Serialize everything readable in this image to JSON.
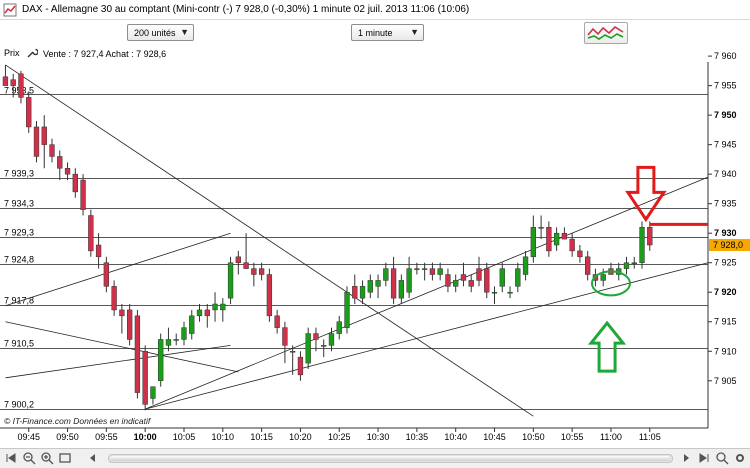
{
  "window": {
    "title": "DAX - Allemagne 30 au comptant (Mini-contr (-)   7 928,0 (-0,30%)     1 minute   02 juil. 2013 11:06 (10:06)"
  },
  "toolbar": {
    "units_select": "200 unités",
    "timeframe_select": "1 minute"
  },
  "quote": {
    "prix_label": "Prix",
    "vente_achat": "Vente : 7 927,4  Achat : 7 928,6"
  },
  "watermark": "© IT-Finance.com   Données en indicatif",
  "colors": {
    "bull": "#1a9e1a",
    "bear": "#d0314a",
    "red_arrow": "#e41a1a",
    "green_arrow": "#1fa83a",
    "current_price_bg": "#f5a800"
  },
  "chart_data": {
    "type": "candlestick",
    "interval": "1 minute",
    "ylim": [
      7897,
      7959
    ],
    "y_ticks": [
      7905,
      7910,
      7915,
      7920,
      7925,
      7930,
      7935,
      7940,
      7945,
      7950,
      7955,
      7960
    ],
    "y_tick_labels": [
      "7 905",
      "7 910",
      "7 915",
      "7 920",
      "7 925",
      "7 930",
      "7 935",
      "7 940",
      "7 945",
      "7 950",
      "7 955",
      "7 960"
    ],
    "y_bold_labels": [
      "7 920",
      "7 930",
      "7 950"
    ],
    "x_labels": [
      "09:45",
      "09:50",
      "09:55",
      "10:00",
      "10:05",
      "10:10",
      "10:15",
      "10:20",
      "10:25",
      "10:30",
      "10:35",
      "10:40",
      "10:45",
      "10:50",
      "10:55",
      "11:00",
      "11:05"
    ],
    "x_label_minutes": [
      585,
      590,
      595,
      600,
      605,
      610,
      615,
      620,
      625,
      630,
      635,
      640,
      645,
      650,
      655,
      660,
      665
    ],
    "x_bold_label": "10:00",
    "current_price": "7 928,0",
    "current_price_value": 7928,
    "horizontal_levels": [
      {
        "value": 7953.5,
        "label": ""
      },
      {
        "value": 7939.3,
        "label": "7 939,3"
      },
      {
        "value": 7934.3,
        "label": "7 934,3"
      },
      {
        "value": 7929.3,
        "label": "7 929,3"
      },
      {
        "value": 7924.8,
        "label": "7 924,8"
      },
      {
        "value": 7917.8,
        "label": "7 917,8"
      },
      {
        "value": 7910.5,
        "label": "7 910,5"
      },
      {
        "value": 7900.2,
        "label": "7 900,2"
      }
    ],
    "extra_level_labels": [
      {
        "value": 7955.7,
        "label": "7 953,5"
      }
    ],
    "trendlines": [
      {
        "from": [
          582,
          7958.5
        ],
        "to": [
          650,
          7899
        ]
      },
      {
        "from": [
          582,
          7917.7
        ],
        "to": [
          611,
          7930.0
        ]
      },
      {
        "from": [
          582,
          7905.5
        ],
        "to": [
          611,
          7911.0
        ]
      },
      {
        "from": [
          600,
          7900.2
        ],
        "to": [
          672.5,
          7939.5
        ]
      },
      {
        "from": [
          600,
          7900.2
        ],
        "to": [
          672.5,
          7925.0
        ]
      },
      {
        "from": [
          582,
          7915.0
        ],
        "to": [
          612,
          7906.5
        ]
      }
    ],
    "candles": [
      {
        "t": 582,
        "o": 7956.5,
        "h": 7958.5,
        "l": 7955,
        "c": 7955
      },
      {
        "t": 583,
        "o": 7956,
        "h": 7957,
        "l": 7953,
        "c": 7955
      },
      {
        "t": 584,
        "o": 7957,
        "h": 7957.5,
        "l": 7952,
        "c": 7953
      },
      {
        "t": 585,
        "o": 7953,
        "h": 7954,
        "l": 7947,
        "c": 7948
      },
      {
        "t": 586,
        "o": 7948,
        "h": 7949,
        "l": 7942,
        "c": 7943
      },
      {
        "t": 587,
        "o": 7948,
        "h": 7950,
        "l": 7941,
        "c": 7945
      },
      {
        "t": 588,
        "o": 7945,
        "h": 7946,
        "l": 7942,
        "c": 7943
      },
      {
        "t": 589,
        "o": 7943,
        "h": 7944,
        "l": 7939,
        "c": 7941
      },
      {
        "t": 590,
        "o": 7941,
        "h": 7942,
        "l": 7939,
        "c": 7940
      },
      {
        "t": 591,
        "o": 7940,
        "h": 7941,
        "l": 7936,
        "c": 7937
      },
      {
        "t": 592,
        "o": 7939,
        "h": 7940,
        "l": 7933,
        "c": 7934
      },
      {
        "t": 593,
        "o": 7933,
        "h": 7934,
        "l": 7926,
        "c": 7927
      },
      {
        "t": 594,
        "o": 7928,
        "h": 7930,
        "l": 7924,
        "c": 7926
      },
      {
        "t": 595,
        "o": 7925,
        "h": 7926,
        "l": 7920,
        "c": 7921
      },
      {
        "t": 596,
        "o": 7921,
        "h": 7922,
        "l": 7916,
        "c": 7917
      },
      {
        "t": 597,
        "o": 7917,
        "h": 7918,
        "l": 7913,
        "c": 7916
      },
      {
        "t": 598,
        "o": 7917,
        "h": 7918,
        "l": 7911,
        "c": 7912
      },
      {
        "t": 599,
        "o": 7916,
        "h": 7917,
        "l": 7902,
        "c": 7903
      },
      {
        "t": 600,
        "o": 7910,
        "h": 7911,
        "l": 7900,
        "c": 7901
      },
      {
        "t": 601,
        "o": 7902,
        "h": 7904,
        "l": 7901,
        "c": 7904
      },
      {
        "t": 602,
        "o": 7905,
        "h": 7913,
        "l": 7904,
        "c": 7912
      },
      {
        "t": 603,
        "o": 7911,
        "h": 7914,
        "l": 7910,
        "c": 7912
      },
      {
        "t": 604,
        "o": 7912,
        "h": 7913,
        "l": 7911,
        "c": 7912
      },
      {
        "t": 605,
        "o": 7912,
        "h": 7915,
        "l": 7911,
        "c": 7914
      },
      {
        "t": 606,
        "o": 7913,
        "h": 7917,
        "l": 7912,
        "c": 7916
      },
      {
        "t": 607,
        "o": 7916,
        "h": 7918,
        "l": 7915,
        "c": 7917
      },
      {
        "t": 608,
        "o": 7917,
        "h": 7918,
        "l": 7914,
        "c": 7916
      },
      {
        "t": 609,
        "o": 7917,
        "h": 7920,
        "l": 7915,
        "c": 7918
      },
      {
        "t": 610,
        "o": 7917,
        "h": 7919,
        "l": 7915,
        "c": 7918
      },
      {
        "t": 611,
        "o": 7919,
        "h": 7926,
        "l": 7918,
        "c": 7925
      },
      {
        "t": 612,
        "o": 7926,
        "h": 7927,
        "l": 7923,
        "c": 7925
      },
      {
        "t": 613,
        "o": 7925,
        "h": 7930,
        "l": 7924,
        "c": 7924
      },
      {
        "t": 614,
        "o": 7924,
        "h": 7925,
        "l": 7921,
        "c": 7923
      },
      {
        "t": 615,
        "o": 7924,
        "h": 7925,
        "l": 7922,
        "c": 7923
      },
      {
        "t": 616,
        "o": 7923,
        "h": 7924,
        "l": 7915,
        "c": 7916
      },
      {
        "t": 617,
        "o": 7916,
        "h": 7917,
        "l": 7913,
        "c": 7914
      },
      {
        "t": 618,
        "o": 7914,
        "h": 7915,
        "l": 7908,
        "c": 7911
      },
      {
        "t": 619,
        "o": 7910,
        "h": 7911,
        "l": 7906,
        "c": 7910
      },
      {
        "t": 620,
        "o": 7909,
        "h": 7910,
        "l": 7905,
        "c": 7906
      },
      {
        "t": 621,
        "o": 7908,
        "h": 7914,
        "l": 7907,
        "c": 7913
      },
      {
        "t": 622,
        "o": 7913,
        "h": 7914,
        "l": 7910,
        "c": 7912
      },
      {
        "t": 623,
        "o": 7911,
        "h": 7912,
        "l": 7909,
        "c": 7911
      },
      {
        "t": 624,
        "o": 7911,
        "h": 7914,
        "l": 7910,
        "c": 7913
      },
      {
        "t": 625,
        "o": 7913,
        "h": 7916,
        "l": 7912,
        "c": 7915
      },
      {
        "t": 626,
        "o": 7914,
        "h": 7921,
        "l": 7913,
        "c": 7920
      },
      {
        "t": 627,
        "o": 7921,
        "h": 7923,
        "l": 7918,
        "c": 7919
      },
      {
        "t": 628,
        "o": 7919,
        "h": 7922,
        "l": 7918,
        "c": 7921
      },
      {
        "t": 629,
        "o": 7920,
        "h": 7923,
        "l": 7919,
        "c": 7922
      },
      {
        "t": 630,
        "o": 7921,
        "h": 7923,
        "l": 7919,
        "c": 7922
      },
      {
        "t": 631,
        "o": 7922,
        "h": 7925,
        "l": 7921,
        "c": 7924
      },
      {
        "t": 632,
        "o": 7924,
        "h": 7926,
        "l": 7918,
        "c": 7919
      },
      {
        "t": 633,
        "o": 7919,
        "h": 7923,
        "l": 7918,
        "c": 7922
      },
      {
        "t": 634,
        "o": 7920,
        "h": 7926,
        "l": 7919,
        "c": 7924
      },
      {
        "t": 635,
        "o": 7924,
        "h": 7925,
        "l": 7923,
        "c": 7924
      },
      {
        "t": 636,
        "o": 7924,
        "h": 7925,
        "l": 7922,
        "c": 7924
      },
      {
        "t": 637,
        "o": 7924,
        "h": 7925,
        "l": 7922,
        "c": 7923
      },
      {
        "t": 638,
        "o": 7923,
        "h": 7925,
        "l": 7922,
        "c": 7924
      },
      {
        "t": 639,
        "o": 7923,
        "h": 7924,
        "l": 7920,
        "c": 7921
      },
      {
        "t": 640,
        "o": 7921,
        "h": 7923,
        "l": 7920,
        "c": 7922
      },
      {
        "t": 641,
        "o": 7923,
        "h": 7925,
        "l": 7921,
        "c": 7922
      },
      {
        "t": 642,
        "o": 7922,
        "h": 7923,
        "l": 7920,
        "c": 7921
      },
      {
        "t": 643,
        "o": 7924,
        "h": 7926,
        "l": 7921,
        "c": 7922
      },
      {
        "t": 644,
        "o": 7924,
        "h": 7925,
        "l": 7919,
        "c": 7920
      },
      {
        "t": 645,
        "o": 7920,
        "h": 7921,
        "l": 7918,
        "c": 7920
      },
      {
        "t": 646,
        "o": 7921,
        "h": 7925,
        "l": 7920,
        "c": 7924
      },
      {
        "t": 647,
        "o": 7920,
        "h": 7921,
        "l": 7919,
        "c": 7920
      },
      {
        "t": 648,
        "o": 7921,
        "h": 7925,
        "l": 7920,
        "c": 7924
      },
      {
        "t": 649,
        "o": 7923,
        "h": 7927,
        "l": 7922,
        "c": 7926
      },
      {
        "t": 650,
        "o": 7926,
        "h": 7933,
        "l": 7925,
        "c": 7931
      },
      {
        "t": 651,
        "o": 7931,
        "h": 7933,
        "l": 7929,
        "c": 7931
      },
      {
        "t": 652,
        "o": 7931,
        "h": 7932,
        "l": 7926,
        "c": 7927
      },
      {
        "t": 653,
        "o": 7928,
        "h": 7931,
        "l": 7927,
        "c": 7930
      },
      {
        "t": 654,
        "o": 7930,
        "h": 7931,
        "l": 7929,
        "c": 7929
      },
      {
        "t": 655,
        "o": 7929,
        "h": 7930,
        "l": 7926,
        "c": 7927
      },
      {
        "t": 656,
        "o": 7927,
        "h": 7928,
        "l": 7925,
        "c": 7926
      },
      {
        "t": 657,
        "o": 7926,
        "h": 7927,
        "l": 7922,
        "c": 7923
      },
      {
        "t": 658,
        "o": 7923,
        "h": 7924,
        "l": 7921,
        "c": 7922
      },
      {
        "t": 659,
        "o": 7922,
        "h": 7924,
        "l": 7921,
        "c": 7923
      },
      {
        "t": 660,
        "o": 7924,
        "h": 7925,
        "l": 7923,
        "c": 7923
      },
      {
        "t": 661,
        "o": 7923,
        "h": 7925,
        "l": 7922,
        "c": 7924
      },
      {
        "t": 662,
        "o": 7924,
        "h": 7926,
        "l": 7923,
        "c": 7925
      },
      {
        "t": 663,
        "o": 7925,
        "h": 7926,
        "l": 7924,
        "c": 7925
      },
      {
        "t": 664,
        "o": 7925,
        "h": 7932,
        "l": 7924,
        "c": 7931
      },
      {
        "t": 665,
        "o": 7931,
        "h": 7932,
        "l": 7927,
        "c": 7928
      }
    ],
    "annotations": [
      {
        "type": "down-arrow",
        "color": "red",
        "t": 664.5,
        "y_tip": 7932
      },
      {
        "type": "horizontal-mark",
        "color": "red",
        "from": 665,
        "to": 672.5,
        "y": 7931.5
      },
      {
        "type": "ellipse",
        "color": "green",
        "t": 660,
        "y": 7921.5
      },
      {
        "type": "up-arrow",
        "color": "green",
        "t": 659.5,
        "y_tip": 7918.5
      }
    ]
  }
}
